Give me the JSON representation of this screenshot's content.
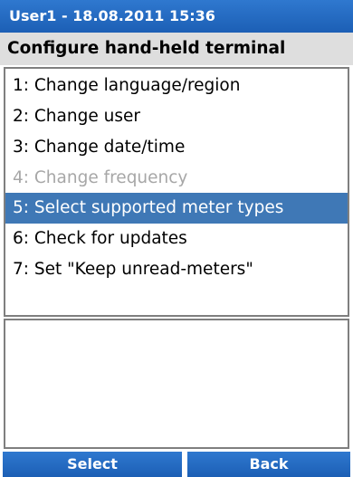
{
  "title_bar": {
    "text": "User1 - 18.08.2011 15:36"
  },
  "heading": {
    "text": "Configure hand-held terminal"
  },
  "menu": {
    "items": [
      {
        "label": "1: Change language/region",
        "state": "normal"
      },
      {
        "label": "2: Change user",
        "state": "normal"
      },
      {
        "label": "3: Change date/time",
        "state": "normal"
      },
      {
        "label": "4: Change frequency",
        "state": "disabled"
      },
      {
        "label": "5: Select supported meter types",
        "state": "selected"
      },
      {
        "label": "6: Check for updates",
        "state": "normal"
      },
      {
        "label": "7: Set \"Keep unread-meters\"",
        "state": "normal"
      }
    ]
  },
  "softkeys": {
    "left_label": "Select",
    "right_label": "Back"
  },
  "colors": {
    "title_blue": "#1c5fb5",
    "selection_blue": "#3f78b6",
    "disabled_text": "#a7a7a7",
    "heading_bg": "#dedede"
  }
}
